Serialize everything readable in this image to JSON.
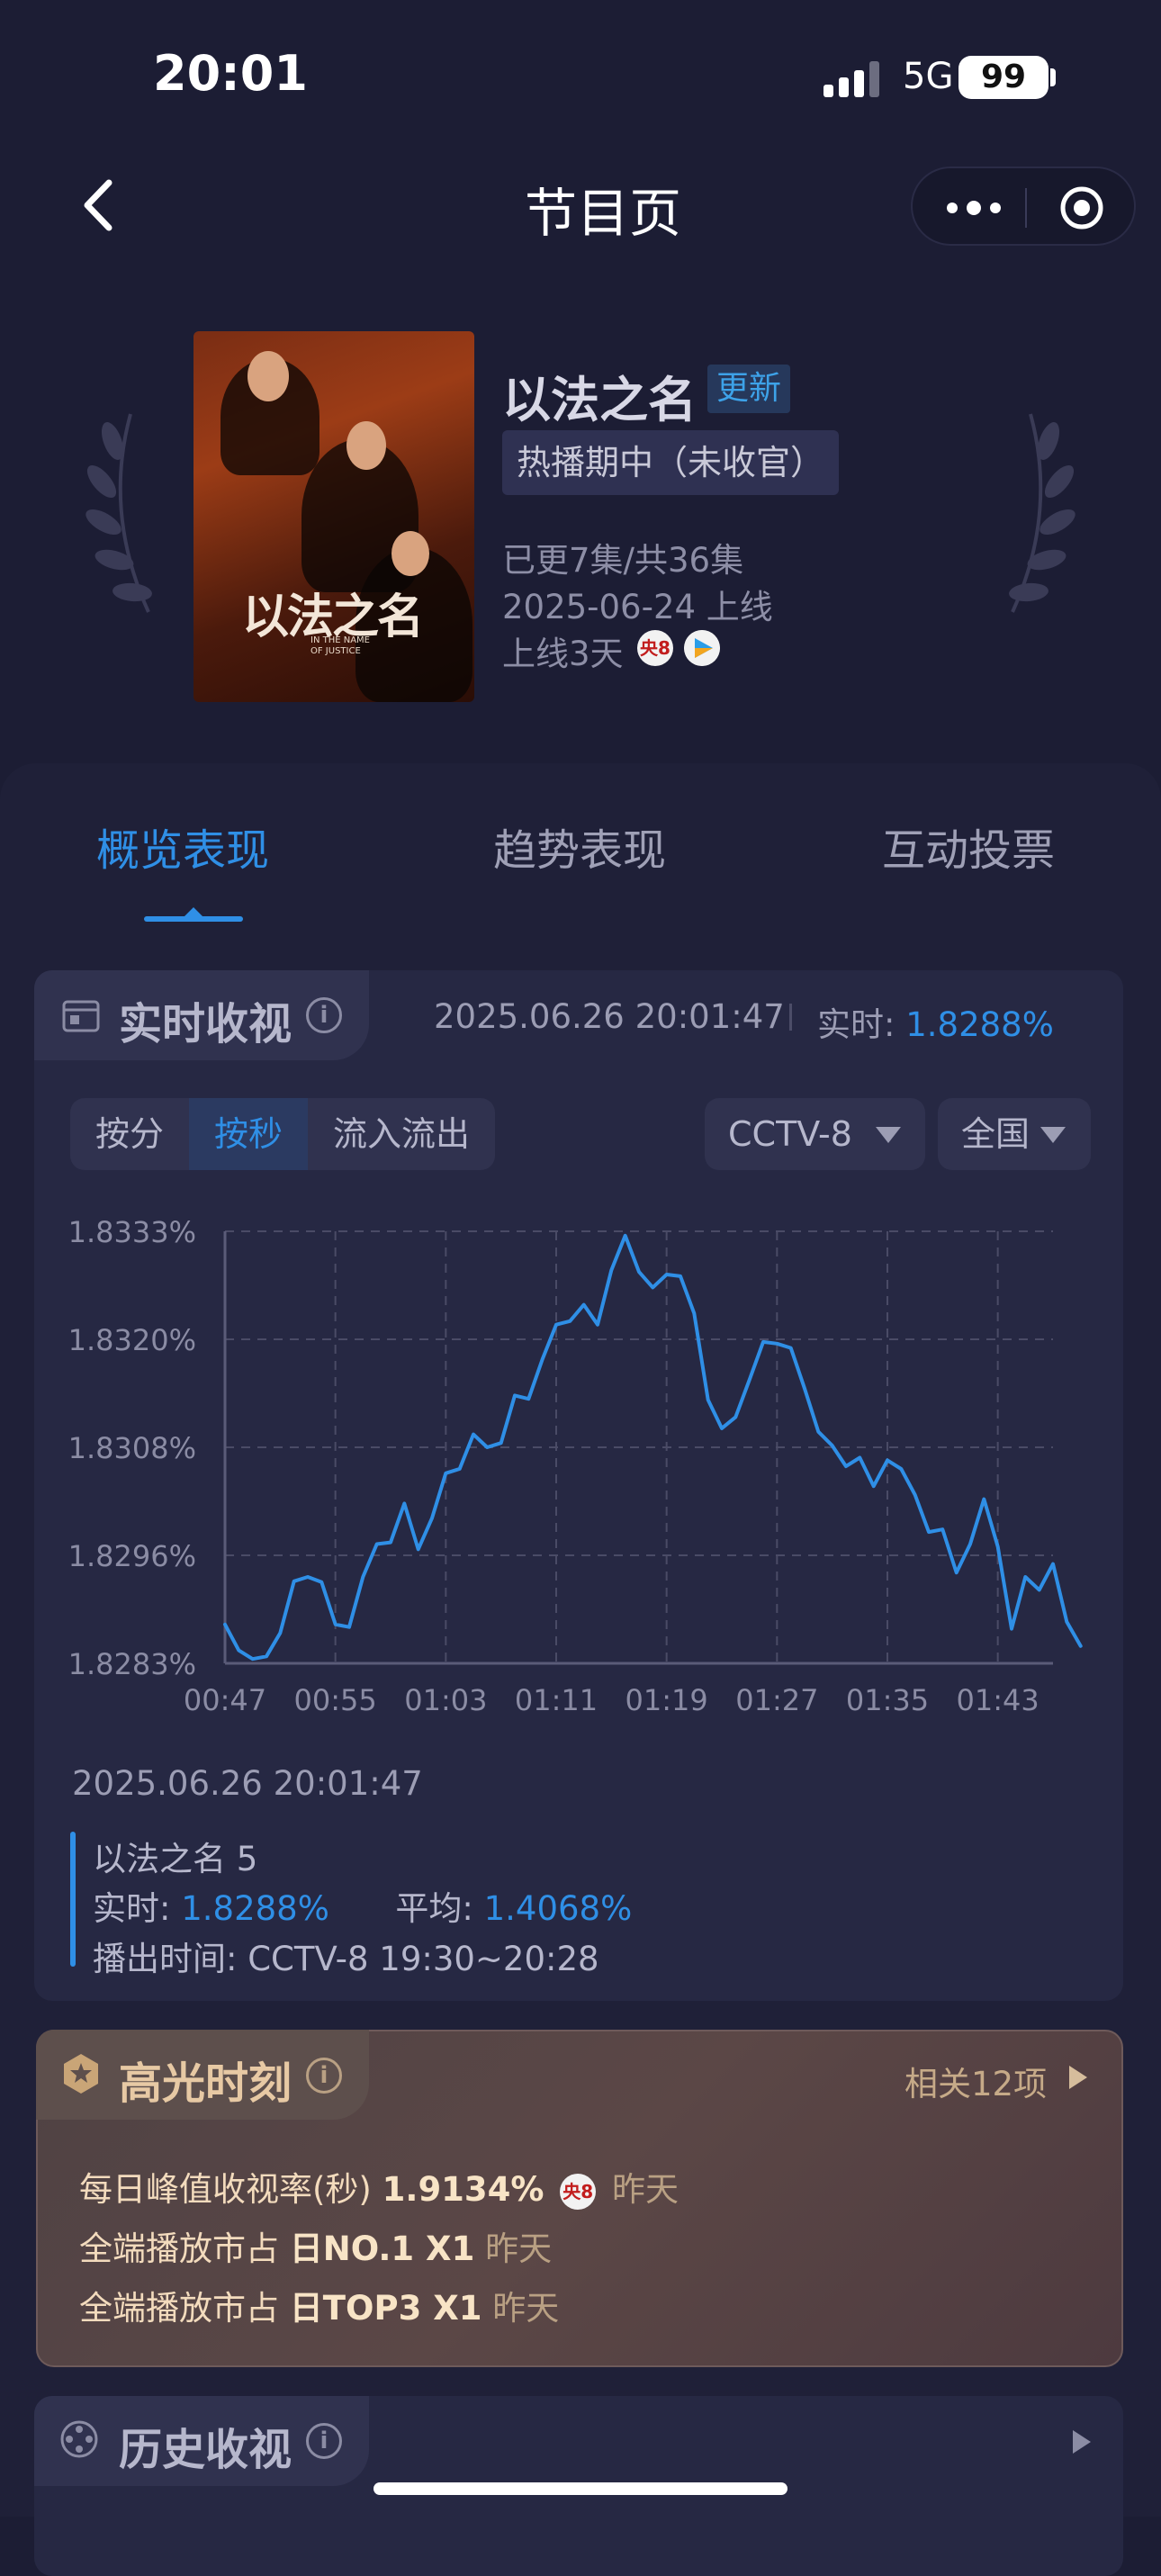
{
  "status_bar": {
    "time": "20:01",
    "network": "5G",
    "battery": "99"
  },
  "nav": {
    "title": "节目页"
  },
  "program": {
    "poster_title": "以法之名",
    "poster_subtitle": "IN THE NAME OF JUSTICE",
    "name": "以法之名",
    "update_tag": "更新",
    "status": "热播期中（未收官）",
    "episodes": "已更7集/共36集",
    "premiere": "2025-06-24 上线",
    "days_online": "上线3天",
    "channel_badge": "央8"
  },
  "tabs": [
    "概览表现",
    "趋势表现",
    "互动投票"
  ],
  "realtime": {
    "title": "实时收视",
    "info": "i",
    "timestamp": "2025.06.26 20:01:47",
    "realtime_label": "实时:",
    "realtime_value": "1.8288%",
    "segments": [
      "按分",
      "按秒",
      "流入流出"
    ],
    "channel_select": "CCTV-8",
    "region_select": "全国"
  },
  "chart_data": {
    "type": "line",
    "title": "",
    "xlabel": "",
    "ylabel": "",
    "x_ticks": [
      "00:47",
      "00:55",
      "01:03",
      "01:11",
      "01:19",
      "01:27",
      "01:35",
      "01:43"
    ],
    "y_ticks": [
      "1.8283%",
      "1.8296%",
      "1.8308%",
      "1.8320%",
      "1.8333%"
    ],
    "ylim": [
      1.8283,
      1.8333
    ],
    "xlim": [
      47,
      107
    ],
    "x_unit": "seconds",
    "grid": true,
    "series": [
      {
        "color": "#2f8fe6",
        "points": [
          [
            47,
            1.82875
          ],
          [
            48,
            1.82845
          ],
          [
            49,
            1.82835
          ],
          [
            50,
            1.82838
          ],
          [
            51,
            1.82865
          ],
          [
            52,
            1.82925
          ],
          [
            53,
            1.8293
          ],
          [
            54,
            1.82924
          ],
          [
            55,
            1.82875
          ],
          [
            56,
            1.82872
          ],
          [
            57,
            1.8293
          ],
          [
            58,
            1.82968
          ],
          [
            59,
            1.8297
          ],
          [
            60,
            1.83015
          ],
          [
            61,
            1.82962
          ],
          [
            62,
            1.82998
          ],
          [
            63,
            1.8305
          ],
          [
            64,
            1.83055
          ],
          [
            65,
            1.83095
          ],
          [
            66,
            1.8308
          ],
          [
            67,
            1.83085
          ],
          [
            68,
            1.8314
          ],
          [
            69,
            1.83136
          ],
          [
            70,
            1.83182
          ],
          [
            71,
            1.83222
          ],
          [
            72,
            1.83226
          ],
          [
            73,
            1.83245
          ],
          [
            74,
            1.83222
          ],
          [
            75,
            1.83285
          ],
          [
            76,
            1.83325
          ],
          [
            77,
            1.83283
          ],
          [
            78,
            1.83265
          ],
          [
            79,
            1.8328
          ],
          [
            80,
            1.83278
          ],
          [
            81,
            1.83235
          ],
          [
            82,
            1.83135
          ],
          [
            83,
            1.83102
          ],
          [
            84,
            1.83115
          ],
          [
            85,
            1.83158
          ],
          [
            86,
            1.83202
          ],
          [
            87,
            1.832
          ],
          [
            88,
            1.83195
          ],
          [
            89,
            1.83148
          ],
          [
            90,
            1.83098
          ],
          [
            91,
            1.83082
          ],
          [
            92,
            1.83058
          ],
          [
            93,
            1.83068
          ],
          [
            94,
            1.83035
          ],
          [
            95,
            1.83065
          ],
          [
            96,
            1.83055
          ],
          [
            97,
            1.83025
          ],
          [
            98,
            1.82982
          ],
          [
            99,
            1.82985
          ],
          [
            100,
            1.82935
          ],
          [
            101,
            1.82968
          ],
          [
            102,
            1.8302
          ],
          [
            103,
            1.82965
          ],
          [
            104,
            1.8287
          ],
          [
            105,
            1.8293
          ],
          [
            106,
            1.82915
          ],
          [
            107,
            1.82945
          ],
          [
            108,
            1.82878
          ],
          [
            109,
            1.8285
          ]
        ]
      }
    ]
  },
  "detail": {
    "date": "2025.06.26 20:01:47",
    "episode": "以法之名 5",
    "realtime_label": "实时:",
    "realtime_value": "1.8288%",
    "average_label": "平均:",
    "average_value": "1.4068%",
    "airtime": "播出时间:  CCTV-8 19:30~20:28"
  },
  "highlight": {
    "title": "高光时刻",
    "more": "相关12项",
    "items": [
      {
        "label": "每日峰值收视率(秒)",
        "value": "1.9134%",
        "badge": "央8",
        "when": "昨天"
      },
      {
        "label": "全端播放市占",
        "value": "日NO.1 X1",
        "when": "昨天"
      },
      {
        "label": "全端播放市占",
        "value": "日TOP3 X1",
        "when": "昨天"
      }
    ]
  },
  "history": {
    "title": "历史收视"
  },
  "colors": {
    "accent": "#2f8fe6",
    "background": "#1c1d34",
    "highlight_text": "#e7c9a4"
  }
}
